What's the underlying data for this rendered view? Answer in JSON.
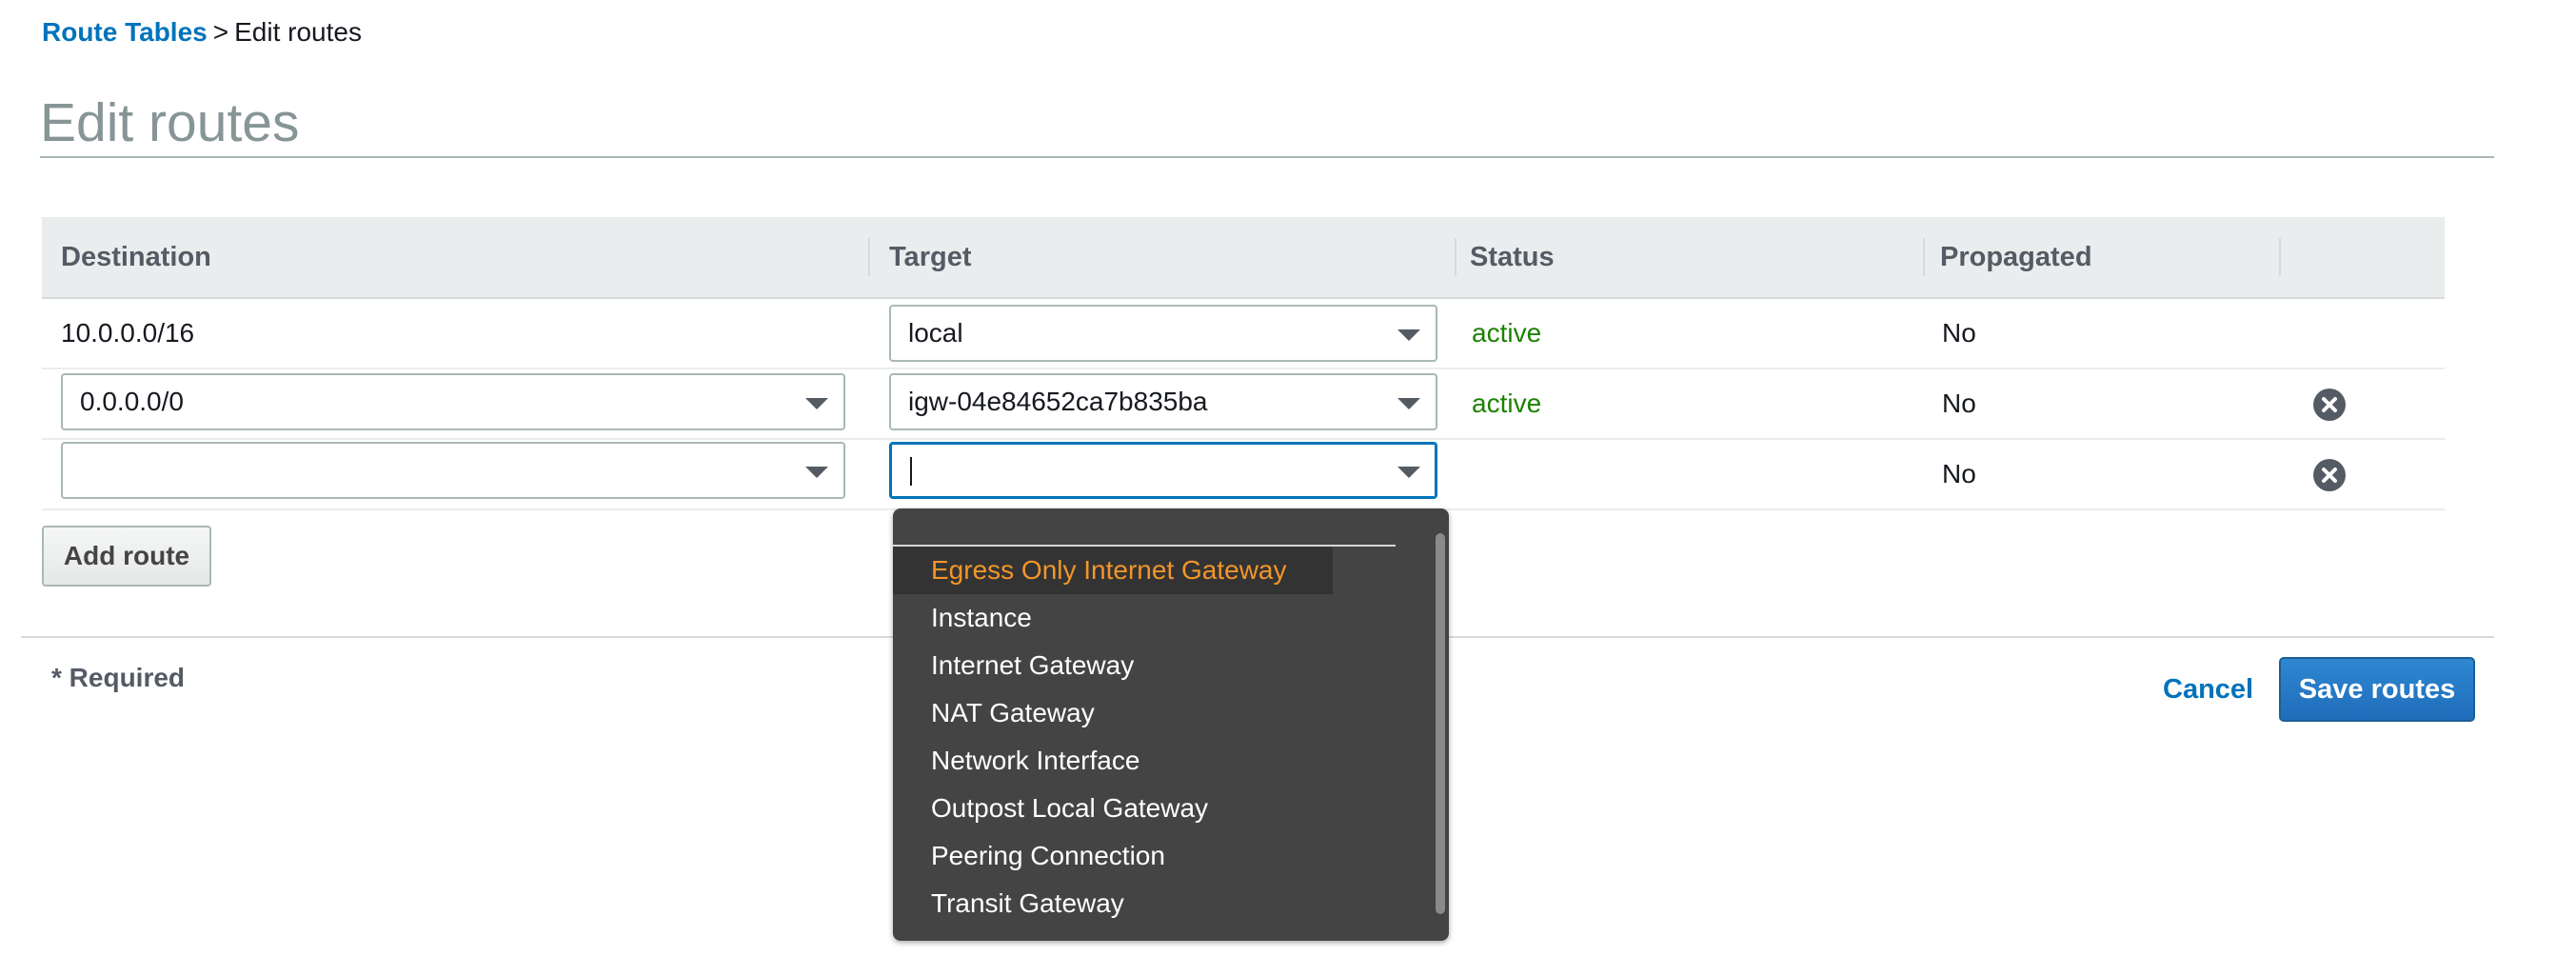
{
  "breadcrumb": {
    "parent": "Route Tables",
    "separator": ">",
    "current": "Edit routes"
  },
  "page": {
    "title": "Edit routes"
  },
  "table": {
    "headers": [
      "Destination",
      "Target",
      "Status",
      "Propagated"
    ],
    "rows": [
      {
        "destination": "10.0.0.0/16",
        "target": "local",
        "status": "active",
        "propagated": "No"
      },
      {
        "destination": "0.0.0.0/0",
        "target": "igw-04e84652ca7b835ba",
        "status": "active",
        "propagated": "No"
      },
      {
        "destination": "",
        "target": "",
        "status": "",
        "propagated": "No"
      }
    ]
  },
  "target_dropdown": {
    "options": [
      "Egress Only Internet Gateway",
      "Instance",
      "Internet Gateway",
      "NAT Gateway",
      "Network Interface",
      "Outpost Local Gateway",
      "Peering Connection",
      "Transit Gateway"
    ],
    "highlighted": "Egress Only Internet Gateway"
  },
  "actions": {
    "add_route": "Add route",
    "cancel": "Cancel",
    "save_routes": "Save routes"
  },
  "footer": {
    "required_note": "* Required"
  },
  "colors": {
    "link": "#0073bb",
    "status_active": "#1d8102",
    "primary_button": "#1f6dba",
    "dropdown_bg": "#444444",
    "dropdown_highlight_text": "#f3952a"
  },
  "icons": {
    "remove_row": "remove-circle-x-icon",
    "select_caret": "caret-down-icon"
  }
}
